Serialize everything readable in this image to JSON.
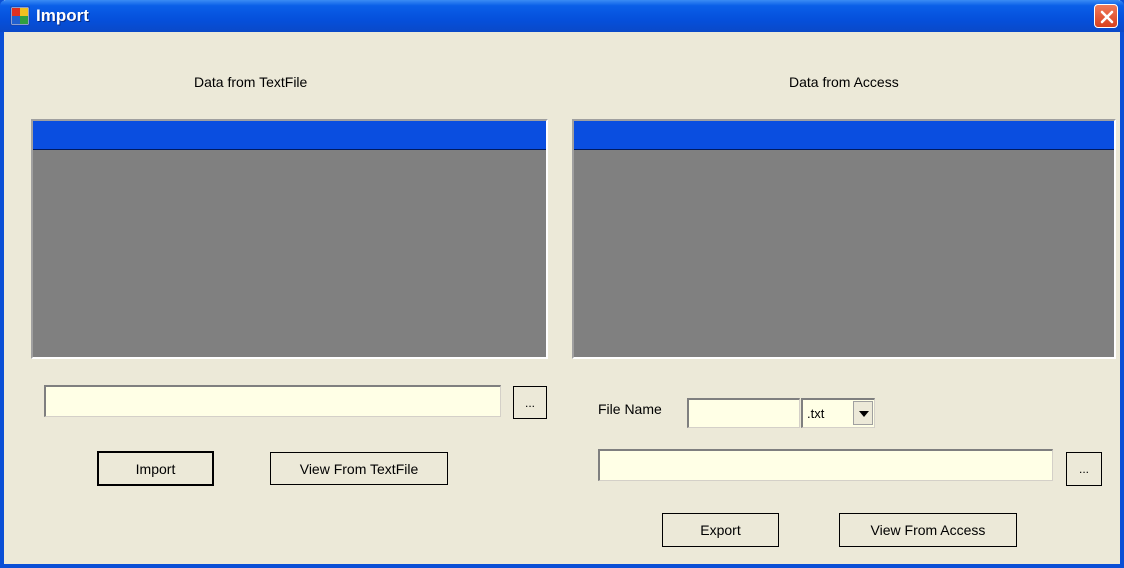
{
  "window": {
    "title": "Import",
    "accent_color": "#0550dc",
    "close_color": "#d8401e"
  },
  "left_panel": {
    "heading": "Data from TextFile",
    "path_value": "",
    "browse_label": "...",
    "import_label": "Import",
    "view_label": "View From TextFile"
  },
  "right_panel": {
    "heading": "Data from Access",
    "file_name_label": "File Name",
    "file_name_value": "",
    "extension_selected": ".txt",
    "path_value": "",
    "browse_label": "...",
    "export_label": "Export",
    "view_label": "View From Access"
  },
  "icons": {
    "app": "window-app-icon",
    "close": "close-icon",
    "dropdown": "chevron-down-icon"
  }
}
